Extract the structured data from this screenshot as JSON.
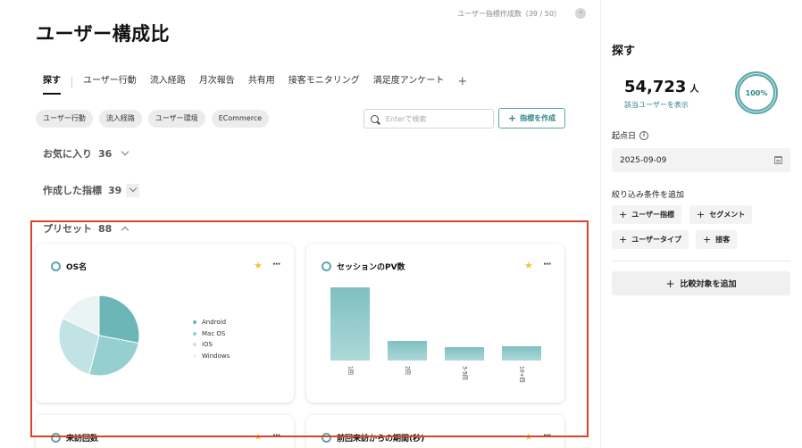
{
  "header": {
    "title": "ユーザー構成比",
    "counter": "ユーザー指標作成数（39 / 50）",
    "help_icon": "help-icon"
  },
  "tabs": [
    {
      "label": "探す",
      "active": true
    },
    {
      "label": "ユーザー行動"
    },
    {
      "label": "流入経路"
    },
    {
      "label": "月次報告"
    },
    {
      "label": "共有用"
    },
    {
      "label": "接客モニタリング"
    },
    {
      "label": "満足度アンケート"
    }
  ],
  "tab_add_label": "+",
  "chips": [
    "ユーザー行動",
    "流入経路",
    "ユーザー環境",
    "ECommerce"
  ],
  "search": {
    "placeholder": "Enterで検索",
    "value": ""
  },
  "create_button": {
    "label": "指標を作成"
  },
  "sections": {
    "favorites": {
      "label": "お気に入り",
      "count": "36"
    },
    "created": {
      "label": "作成した指標",
      "count": "39"
    },
    "preset": {
      "label": "プリセット",
      "count": "88"
    }
  },
  "cards": [
    {
      "title": "OS名",
      "chart_data": {
        "type": "pie",
        "title": "OS名",
        "categories": [
          "Android",
          "Mac OS",
          "iOS",
          "Windows"
        ],
        "values": [
          28,
          26,
          28,
          18
        ],
        "colors": [
          "#6cb6b7",
          "#96cfcf",
          "#c2e3e3",
          "#eaf4f4"
        ]
      }
    },
    {
      "title": "セッションのPV数",
      "chart_data": {
        "type": "bar",
        "title": "セッションのPV数",
        "categories": [
          "1回",
          "2回",
          "3-5回",
          "10+回"
        ],
        "values": [
          82,
          22,
          15,
          16
        ],
        "ylim": [
          0,
          100
        ]
      }
    },
    {
      "title": "来訪回数"
    },
    {
      "title": "前回来訪からの期間(秒)"
    }
  ],
  "right_panel": {
    "title": "探す",
    "user_count": "54,723",
    "user_unit": "人",
    "show_users_link": "該当ユーザーを表示",
    "percent": "100%",
    "start_date_label": "起点日",
    "start_date": "2025-09-09",
    "filter_label": "絞り込み条件を追加",
    "filters": [
      "ユーザー指標",
      "セグメント",
      "ユーザータイプ",
      "接客"
    ],
    "compare_label": "比較対象を追加"
  },
  "colors": {
    "accent": "#5aa7a9",
    "accent_text": "#2f8588",
    "star": "#f5c33b",
    "highlight_frame": "#d9452c"
  }
}
